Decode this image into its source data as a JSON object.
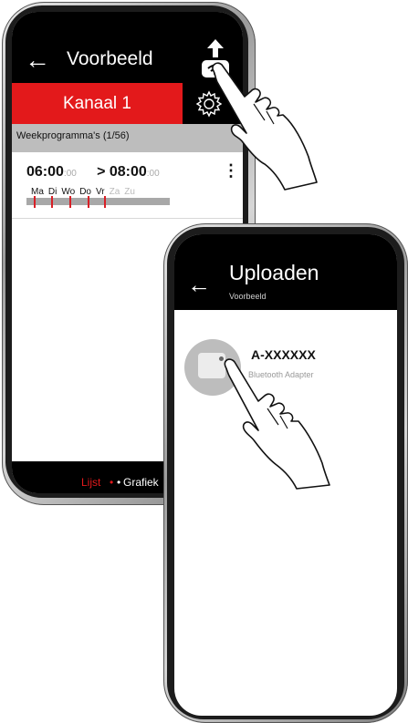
{
  "phone1": {
    "header": {
      "back_glyph": "←",
      "title": "Voorbeeld",
      "upload_icon": "upload-bluetooth-icon"
    },
    "channel": {
      "label": "Kanaal 1",
      "settings_icon": "gear-icon"
    },
    "week_program": {
      "label": "Weekprogramma's (1/56)"
    },
    "schedule": {
      "start": "06:00",
      "start_seconds": ":00",
      "end": "> 08:00",
      "end_seconds": ":00",
      "menu_glyph": "⋮",
      "days": [
        {
          "label": "Ma",
          "active": true
        },
        {
          "label": "Di",
          "active": true
        },
        {
          "label": "Wo",
          "active": true
        },
        {
          "label": "Do",
          "active": true
        },
        {
          "label": "Vr",
          "active": true
        },
        {
          "label": "Za",
          "active": false
        },
        {
          "label": "Zu",
          "active": false
        }
      ]
    },
    "footer": {
      "list_label": "Lijst",
      "dot": "•",
      "dot2": "•",
      "graph_label": "Grafiek"
    }
  },
  "phone2": {
    "header": {
      "back_glyph": "←",
      "title": "Uploaden",
      "subtitle": "Voorbeeld"
    },
    "device": {
      "name": "A-XXXXXX",
      "description": "Bluetooth Adapter",
      "icon": "adapter-icon"
    }
  },
  "colors": {
    "accent": "#e3191b",
    "header": "#000000",
    "weekbar": "#bdbdbd"
  }
}
